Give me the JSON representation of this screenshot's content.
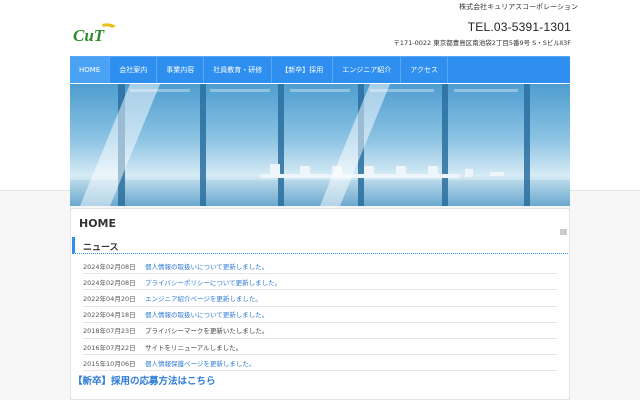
{
  "header": {
    "company_name": "株式会社キュリアスコーポレーション",
    "logo_text": "CuT",
    "tel": "TEL.03-5391-1301",
    "address": "〒171-0022 東京都豊島区南池袋2丁目5番9号 S・SビルⅡ3F"
  },
  "nav": {
    "items": [
      {
        "label": "HOME"
      },
      {
        "label": "会社案内"
      },
      {
        "label": "事業内容"
      },
      {
        "label": "社員教育・研修"
      },
      {
        "label": "【新卒】採用"
      },
      {
        "label": "エンジニア紹介"
      },
      {
        "label": "アクセス"
      }
    ]
  },
  "main": {
    "page_title": "HOME",
    "news_heading": "ニュース",
    "news": [
      {
        "date": "2024年02月08日",
        "text": "個人情報の取扱いについて更新しました。",
        "link": true
      },
      {
        "date": "2024年02月08日",
        "text": "プライバシーポリシーについて更新しました。",
        "link": true
      },
      {
        "date": "2022年04月20日",
        "text": "エンジニア紹介ページを更新しました。",
        "link": true
      },
      {
        "date": "2022年04月18日",
        "text": "個人情報の取扱いについて更新しました。",
        "link": true
      },
      {
        "date": "2018年07月23日",
        "text": "プライバシーマークを更新いたしました。",
        "link": false
      },
      {
        "date": "2016年07月22日",
        "text": "サイトをリニューアルしました。",
        "link": false
      },
      {
        "date": "2015年10月06日",
        "text": "個人情報保護ページを更新しました。",
        "link": true
      }
    ],
    "recruit_link": "【新卒】採用の応募方法はこちら"
  },
  "colors": {
    "accent": "#2e8ff0",
    "link": "#2e7bd6"
  }
}
